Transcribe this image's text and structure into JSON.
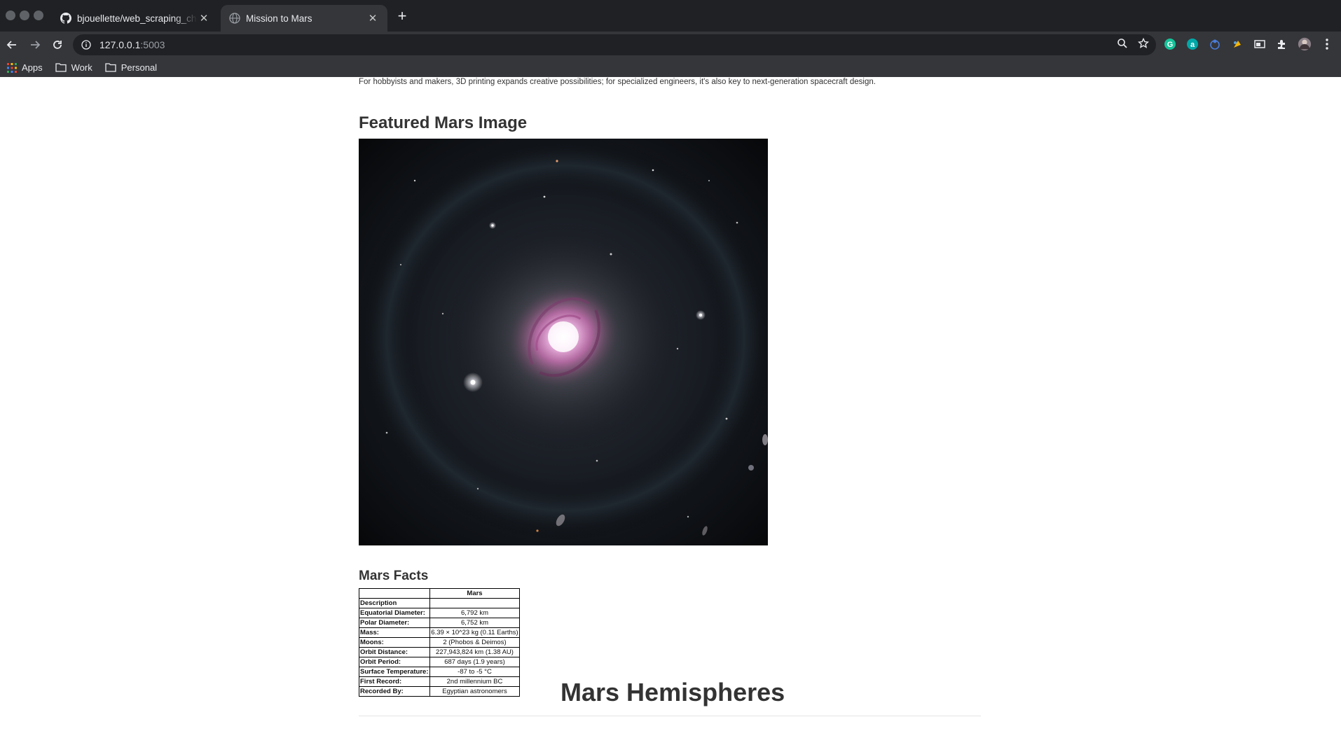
{
  "browser": {
    "tabs": [
      {
        "title": "bjouellette/web_scraping_chall",
        "favicon": "github-icon",
        "active": false
      },
      {
        "title": "Mission to Mars",
        "favicon": "globe-icon",
        "active": true
      }
    ],
    "url_host": "127.0.0.1",
    "url_port": ":5003",
    "bookmarks": [
      {
        "label": "Apps",
        "icon": "apps-grid-icon"
      },
      {
        "label": "Work",
        "icon": "folder-icon"
      },
      {
        "label": "Personal",
        "icon": "folder-icon"
      }
    ],
    "colors": {
      "frame": "#202124",
      "toolbar": "#35363a",
      "text": "#e8eaed"
    }
  },
  "page": {
    "news_paragraph": "For hobbyists and makers, 3D printing expands creative possibilities; for specialized engineers, it's also key to next-generation spacecraft design.",
    "featured_heading": "Featured Mars Image",
    "featured_image_alt": "spiral galaxy image",
    "facts_heading": "Mars Facts",
    "facts_table": {
      "column_header": "Mars",
      "index_header": "Description",
      "rows": [
        {
          "label": "Equatorial Diameter:",
          "value": "6,792 km"
        },
        {
          "label": "Polar Diameter:",
          "value": "6,752 km"
        },
        {
          "label": "Mass:",
          "value": "6.39 × 10^23 kg (0.11 Earths)"
        },
        {
          "label": "Moons:",
          "value": "2 (Phobos & Deimos)"
        },
        {
          "label": "Orbit Distance:",
          "value": "227,943,824 km (1.38 AU)"
        },
        {
          "label": "Orbit Period:",
          "value": "687 days (1.9 years)"
        },
        {
          "label": "Surface Temperature:",
          "value": "-87 to -5 °C"
        },
        {
          "label": "First Record:",
          "value": "2nd millennium BC"
        },
        {
          "label": "Recorded By:",
          "value": "Egyptian astronomers"
        }
      ]
    },
    "hemispheres_heading": "Mars Hemispheres"
  }
}
